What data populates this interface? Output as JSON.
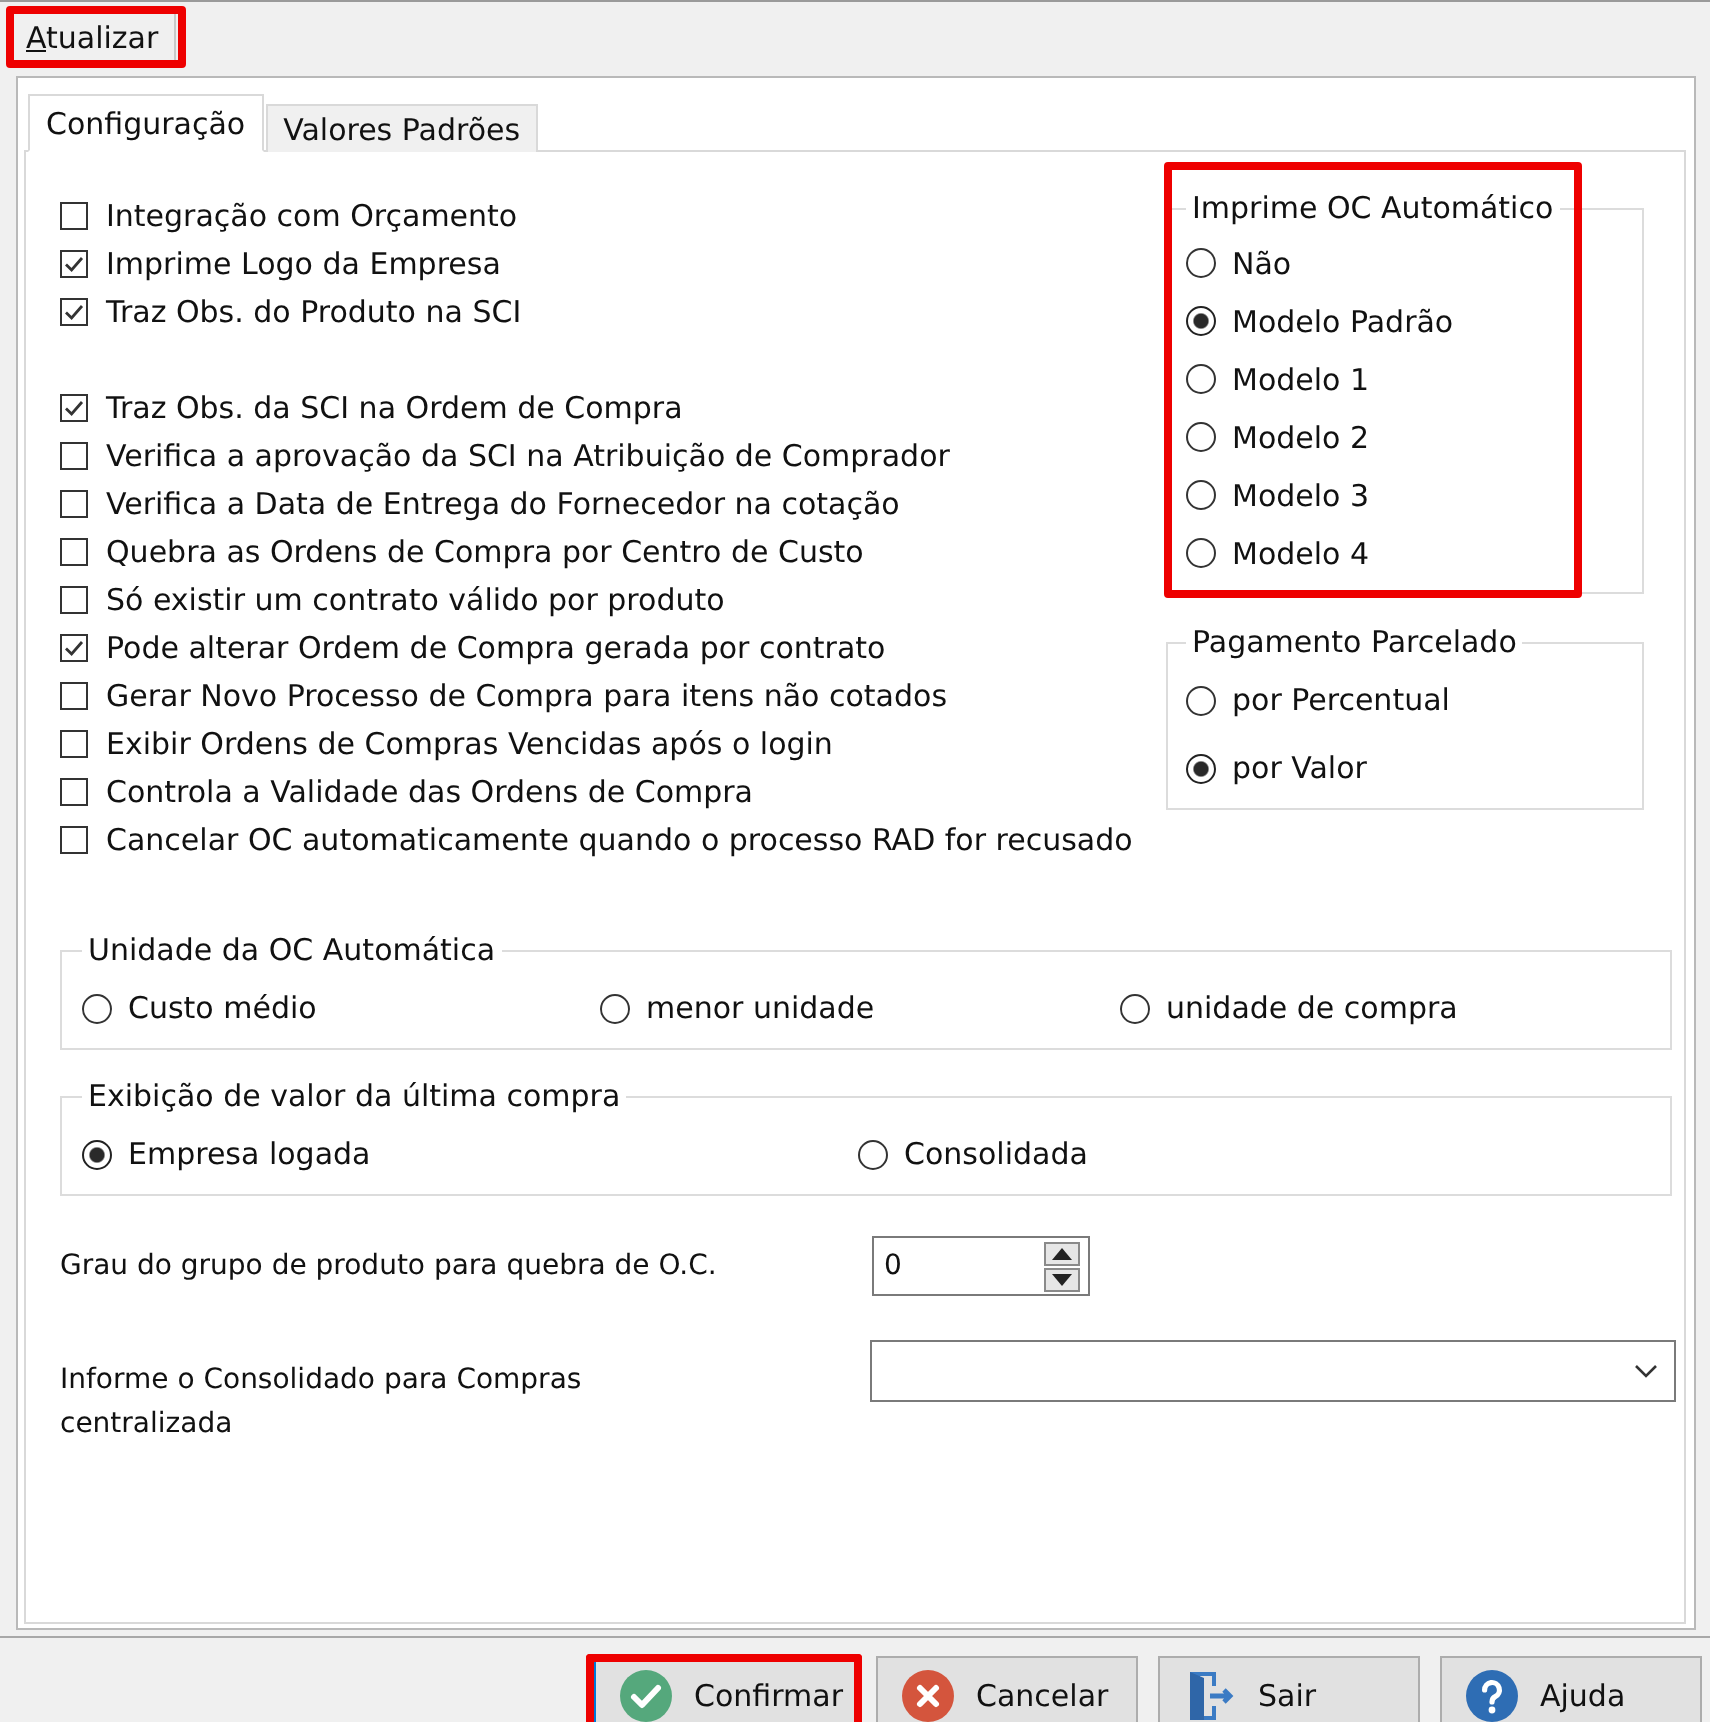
{
  "toolbar": {
    "buttons": [
      {
        "label": "Atualizar",
        "access_key_underlined": true,
        "highlighted": true
      }
    ]
  },
  "tabs": [
    {
      "label": "Configuração",
      "selected": true
    },
    {
      "label": "Valores Padrões",
      "selected": false
    }
  ],
  "option_groups": [
    {
      "items": [
        {
          "label": "Integração com Orçamento",
          "checked": false
        },
        {
          "label": "Imprime Logo da Empresa",
          "checked": true
        },
        {
          "label": "Traz Obs. do Produto na SCI",
          "checked": true
        }
      ]
    },
    {
      "items": [
        {
          "label": "Traz Obs. da SCI na Ordem de Compra",
          "checked": true
        },
        {
          "label": "Verifica a aprovação da SCI na Atribuição de Comprador",
          "checked": false
        },
        {
          "label": "Verifica a Data de Entrega do Fornecedor na cotação",
          "checked": false
        },
        {
          "label": "Quebra as Ordens de Compra por Centro de Custo",
          "checked": false
        },
        {
          "label": "Só existir um contrato válido por produto",
          "checked": false
        },
        {
          "label": "Pode alterar Ordem de Compra gerada por contrato",
          "checked": true
        },
        {
          "label": "Gerar Novo Processo de Compra para itens não cotados",
          "checked": false
        },
        {
          "label": "Exibir Ordens de Compras Vencidas após o login",
          "checked": false
        },
        {
          "label": "Controla a Validade das Ordens de Compra",
          "checked": false
        },
        {
          "label": "Cancelar OC automaticamente quando o processo RAD for recusado",
          "checked": false
        }
      ]
    }
  ],
  "side_groups": [
    {
      "title": "Imprime OC Automático",
      "highlighted": true,
      "options": [
        {
          "label": "Não",
          "selected": false
        },
        {
          "label": "Modelo Padrão",
          "selected": true
        },
        {
          "label": "Modelo 1",
          "selected": false
        },
        {
          "label": "Modelo 2",
          "selected": false
        },
        {
          "label": "Modelo 3",
          "selected": false
        },
        {
          "label": "Modelo 4",
          "selected": false
        }
      ]
    },
    {
      "title": "Pagamento Parcelado",
      "highlighted": false,
      "options": [
        {
          "label": "por Percentual",
          "selected": false
        },
        {
          "label": "por Valor",
          "selected": true
        }
      ]
    }
  ],
  "wide_groups": [
    {
      "title": "Unidade da OC Automática",
      "options": [
        {
          "label": "Custo médio",
          "selected": false
        },
        {
          "label": "menor unidade",
          "selected": false
        },
        {
          "label": "unidade de compra",
          "selected": false
        }
      ]
    },
    {
      "title": "Exibição de valor da última compra",
      "options": [
        {
          "label": "Empresa logada",
          "selected": true
        },
        {
          "label": "Consolidada",
          "selected": false
        }
      ]
    }
  ],
  "group_level_field": {
    "label": "Grau do grupo de produto para quebra de O.C.",
    "value": "0"
  },
  "consolidated_field": {
    "label": "Informe o Consolidado para Compras centralizada"
  },
  "footer_buttons": [
    {
      "kind": "confirm",
      "label": "Confirmar",
      "focused": true,
      "highlighted": true
    },
    {
      "kind": "cancel",
      "label": "Cancelar",
      "focused": false,
      "highlighted": false
    },
    {
      "kind": "exit",
      "label": "Sair",
      "focused": false,
      "highlighted": false
    },
    {
      "kind": "help",
      "label": "Ajuda",
      "focused": false,
      "highlighted": false
    }
  ]
}
